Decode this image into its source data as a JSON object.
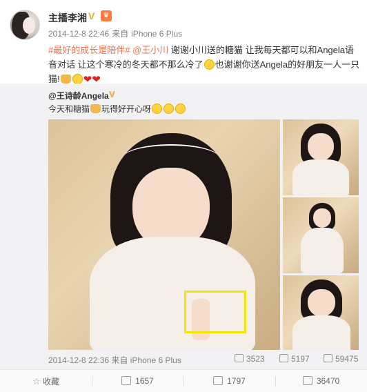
{
  "post": {
    "author": "主播李湘",
    "badges": [
      "verified-v-icon",
      "crown-icon"
    ],
    "time": "2014-12-8 22:46",
    "source_prefix": "来自",
    "source": "iPhone 6 Plus",
    "text": {
      "hashtag": "#最好的成长是陪伴#",
      "mention": "@王小川",
      "part1": " 谢谢小川送的糖猫 让我每天都可以和Angela语音对话 让这个寒冷的冬天都不那么冷了",
      "part2": "也谢谢你送Angela的好朋友一人一只猫!"
    }
  },
  "repost": {
    "author": "@王诗龄Angela",
    "text": "今天和糖猫",
    "text_after_icon": "玩得好开心呀",
    "time": "2014-12-8 22:36",
    "source_prefix": "来自",
    "source": "iPhone 6 Plus",
    "stats": {
      "reposts": "3523",
      "comments": "5197",
      "likes": "59475"
    },
    "photos": [
      "main-photo",
      "thumb-1",
      "thumb-2",
      "thumb-3"
    ]
  },
  "actions": {
    "favorite": "收藏",
    "repost": "1657",
    "comment": "1797",
    "like": "36470"
  },
  "colors": {
    "link": "#eb7350",
    "highlight_box": "#f5e600",
    "repost_bg": "#f2f2f5"
  }
}
